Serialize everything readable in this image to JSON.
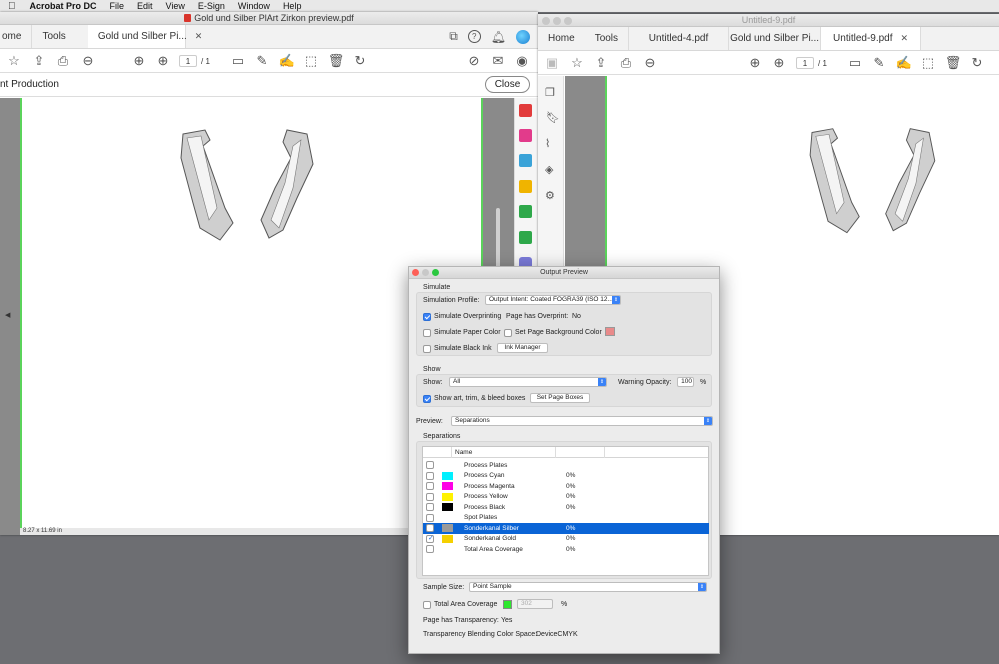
{
  "menubar": {
    "app": "Acrobat Pro DC",
    "items": [
      "File",
      "Edit",
      "View",
      "E-Sign",
      "Window",
      "Help"
    ]
  },
  "left_window": {
    "title": "Gold und Silber PlArt Zirkon preview.pdf",
    "tabs": {
      "home": "ome",
      "tools": "Tools",
      "doc": "Gold und Silber Pi..."
    },
    "page_current": "1",
    "page_total": "/ 1",
    "tool_label": "nt Production",
    "close": "Close",
    "page_size": "8.27 x 11.69 in"
  },
  "right_window": {
    "title": "Untitled-9.pdf",
    "tabs": {
      "home": "Home",
      "tools": "Tools",
      "t1": "Untitled-4.pdf",
      "t2": "Gold und Silber Pi...",
      "t3": "Untitled-9.pdf"
    },
    "page_current": "1",
    "page_total": "/ 1"
  },
  "output_preview": {
    "title": "Output Preview",
    "simulate": {
      "heading": "Simulate",
      "profile_label": "Simulation Profile:",
      "profile_value": "Output Intent: Coated FOGRA39 (ISO 12...",
      "overprint": "Simulate Overprinting",
      "overprint_status_label": "Page has Overprint:",
      "overprint_status": "No",
      "paper": "Simulate Paper Color",
      "bg": "Set Page Background Color",
      "black_ink": "Simulate Black Ink",
      "ink_manager": "Ink Manager"
    },
    "show": {
      "heading": "Show",
      "show_label": "Show:",
      "show_value": "All",
      "warning_label": "Warning Opacity:",
      "warning_value": "100",
      "pct": "%",
      "boxes": "Show art, trim, & bleed boxes",
      "set_boxes": "Set Page Boxes"
    },
    "preview": {
      "label": "Preview:",
      "value": "Separations"
    },
    "separations": {
      "heading": "Separations",
      "col_name": "Name",
      "rows": [
        {
          "name": "Process Plates",
          "pct": "",
          "color": ""
        },
        {
          "name": "Process Cyan",
          "pct": "0%",
          "color": "#00f0ff"
        },
        {
          "name": "Process Magenta",
          "pct": "0%",
          "color": "#ff00e6"
        },
        {
          "name": "Process Yellow",
          "pct": "0%",
          "color": "#fff200"
        },
        {
          "name": "Process Black",
          "pct": "0%",
          "color": "#000000"
        },
        {
          "name": "Spot Plates",
          "pct": "",
          "color": ""
        },
        {
          "name": "Sonderkanal Silber",
          "pct": "0%",
          "color": "#9a9a9a"
        },
        {
          "name": "Sonderkanal Gold",
          "pct": "0%",
          "color": "#f5d000"
        },
        {
          "name": "Total Area Coverage",
          "pct": "0%",
          "color": ""
        }
      ]
    },
    "sample": {
      "label": "Sample Size:",
      "value": "Point Sample"
    },
    "tac": {
      "label": "Total Area Coverage",
      "value": "302",
      "pct": "%"
    },
    "transparency": {
      "label": "Page has Transparency:",
      "value": "Yes"
    },
    "blend": {
      "label": "Transparency Blending Color Space:",
      "value": "DeviceCMYK"
    }
  }
}
